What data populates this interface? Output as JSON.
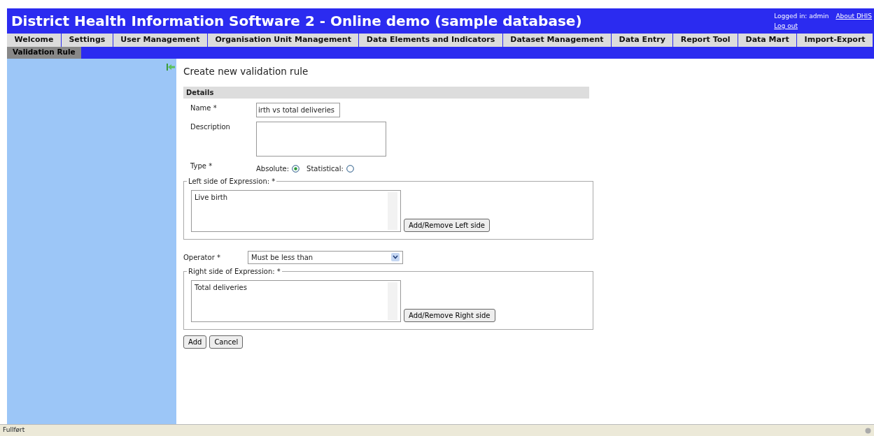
{
  "header": {
    "title": "District Health Information Software 2 - Online demo (sample database)",
    "logged_in": "Logged in: admin",
    "about_link": "About DHIS",
    "logout_link": "Log out"
  },
  "menu": [
    {
      "label": "Welcome",
      "selected": false
    },
    {
      "label": "Settings",
      "selected": false
    },
    {
      "label": "User Management",
      "selected": false
    },
    {
      "label": "Organisation Unit Management",
      "selected": false
    },
    {
      "label": "Data Elements and Indicators",
      "selected": false
    },
    {
      "label": "Dataset Management",
      "selected": false
    },
    {
      "label": "Data Entry",
      "selected": false
    },
    {
      "label": "Report Tool",
      "selected": false
    },
    {
      "label": "Data Mart",
      "selected": false
    },
    {
      "label": "Import-Export",
      "selected": false
    }
  ],
  "submenu": [
    {
      "label": "Validation Rule",
      "selected": true
    }
  ],
  "form": {
    "title": "Create new validation rule",
    "section": "Details",
    "name": {
      "label": "Name *",
      "value": "irth vs total deliveries"
    },
    "description": {
      "label": "Description"
    },
    "type": {
      "label": "Type *",
      "options": [
        {
          "label": "Absolute:",
          "selected": true
        },
        {
          "label": "Statistical:",
          "selected": false
        }
      ]
    },
    "left": {
      "legend": "Left side of Expression: *",
      "items": [
        "Live birth"
      ],
      "button": "Add/Remove Left side"
    },
    "operator": {
      "label": "Operator *",
      "value": "Must be less than"
    },
    "right": {
      "legend": "Right side of Expression: *",
      "items": [
        "Total deliveries"
      ],
      "button": "Add/Remove Right side"
    },
    "buttons": [
      "Add",
      "Cancel"
    ]
  },
  "status_bar": {
    "text": "Fullført"
  }
}
